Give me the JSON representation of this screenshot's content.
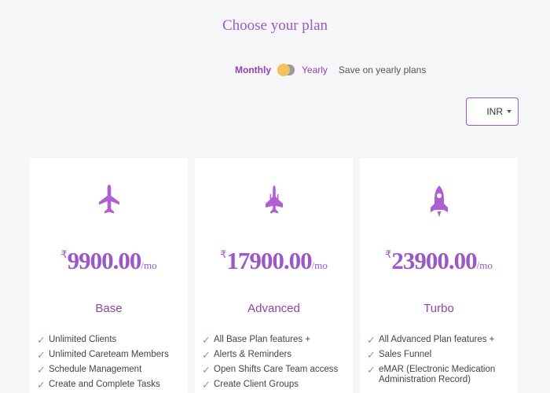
{
  "header": {
    "title": "Choose your plan"
  },
  "billing": {
    "monthly_label": "Monthly",
    "yearly_label": "Yearly",
    "save_text": "Save on yearly plans",
    "selected": "Monthly"
  },
  "currency": {
    "selected": "INR"
  },
  "colors": {
    "accent": "#9b59c6",
    "knob": "#f2c55c",
    "background": "#f6f5f7"
  },
  "plans": [
    {
      "icon": "plane-icon",
      "currency_symbol": "₹",
      "amount": "9900.00",
      "period": "/mo",
      "name": "Base",
      "features": [
        "Unlimited Clients",
        "Unlimited Careteam Members",
        "Schedule Management",
        "Create and Complete Tasks"
      ]
    },
    {
      "icon": "jet-icon",
      "currency_symbol": "₹",
      "amount": "17900.00",
      "period": "/mo",
      "name": "Advanced",
      "features": [
        "All Base Plan features +",
        "Alerts & Reminders",
        "Open Shifts Care Team access",
        "Create Client Groups"
      ]
    },
    {
      "icon": "rocket-icon",
      "currency_symbol": "₹",
      "amount": "23900.00",
      "period": "/mo",
      "name": "Turbo",
      "features": [
        "All Advanced Plan features +",
        "Sales Funnel",
        "eMAR (Electronic Medication Administration Record)"
      ]
    }
  ]
}
